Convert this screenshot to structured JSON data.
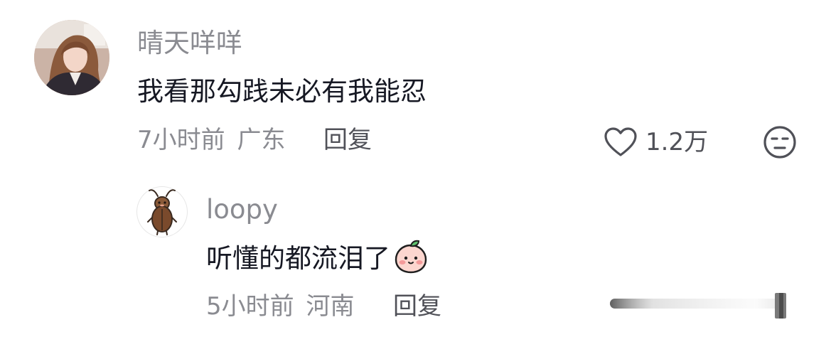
{
  "comment": {
    "username": "晴天咩咩",
    "text": "我看那勾践未必有我能忍",
    "time": "7小时前",
    "location": "广东",
    "reply_label": "回复",
    "like_count": "1.2万",
    "like_icon": "heart-outline-icon",
    "dislike_icon": "unamused-face-icon"
  },
  "reply": {
    "username": "loopy",
    "text": "听懂的都流泪了",
    "emoji": "peach-face-emoji",
    "time": "5小时前",
    "location": "河南",
    "reply_label": "回复"
  },
  "colors": {
    "username": "#8a8b91",
    "text": "#161823",
    "meta": "#8a8b91",
    "action": "#505158"
  }
}
